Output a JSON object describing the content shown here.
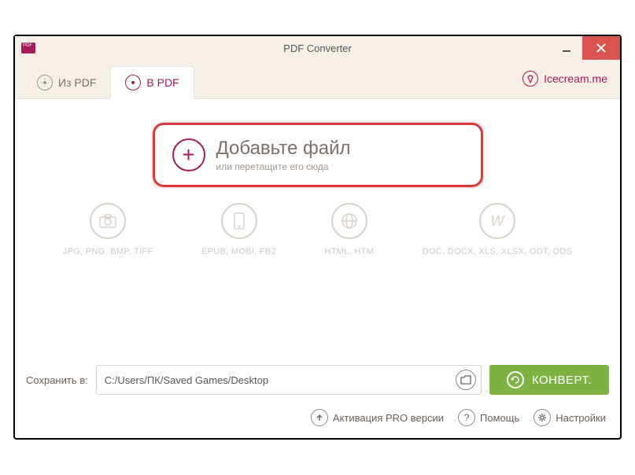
{
  "window": {
    "title": "PDF Converter"
  },
  "tabs": {
    "from": "Из PDF",
    "to": "В PDF"
  },
  "brand": {
    "label": "Icecream.me"
  },
  "add": {
    "title": "Добавьте файл",
    "hint": "или перетащите его сюда"
  },
  "formats": {
    "img": "JPG, PNG, BMP, TIFF",
    "ebook": "EPUB, MOBI, FB2",
    "web": "HTML, HTM",
    "doc": "DOC, DOCX, XLS, XLSX, ODT, ODS"
  },
  "save": {
    "label": "Сохранить в:",
    "path": "C:/Users/ПК/Saved Games/Desktop"
  },
  "convert": {
    "label": "КОНВЕРТ."
  },
  "footer": {
    "pro": "Активация PRO версии",
    "help": "Помощь",
    "settings": "Настройки"
  }
}
